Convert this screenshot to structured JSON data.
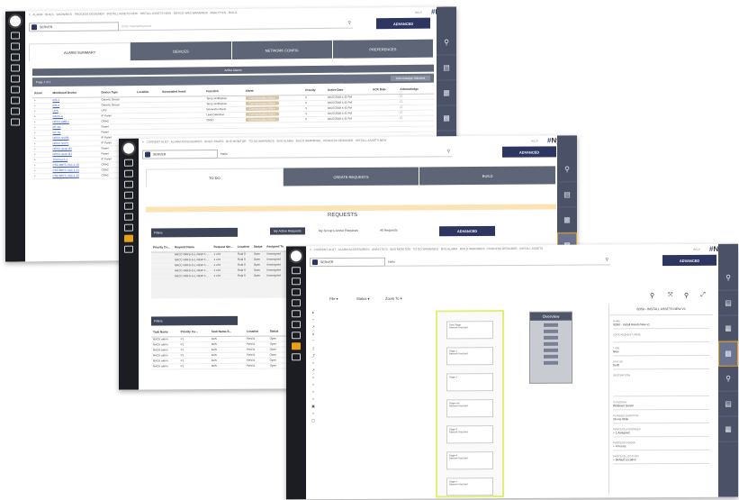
{
  "app": {
    "brand_left": "#",
    "brand_right": "Nyle",
    "help": "HELP",
    "server": "SERVER",
    "advanced": "ADVANCED"
  },
  "win1": {
    "crumbs": "# · ALARM · BUILD · WARNINGS · PROCESS DESIGNER · INSTALL ASSETS NEW · INSTALL ASSETS NEW · DEVICE WAS WARNINGS · ANALYTICS · BUILD",
    "search_placeholder": "Enter Name/keyword",
    "tabs": [
      "ALARM SUMMARY",
      "DEVICES",
      "NETWORK CONFIG",
      "PREFERENCES"
    ],
    "active_alarms": "Active Alarms",
    "page_label": "Page 1 of 1",
    "acknowledge_label": "Acknowledge Selected",
    "columns": [
      "Asset",
      "Monitored Device",
      "Device Type",
      "Location",
      "Associated Asset",
      "Function",
      "Alarm",
      "Priority",
      "Active Date",
      "ACK Date",
      "Acknowledge"
    ],
    "rows": [
      {
        "device": "RIS-1",
        "type": "Generic Device",
        "function": "Temp Verification",
        "alarm": "Communication Alarm",
        "priority": "5",
        "date": "04/27/2018 4:41 PM"
      },
      {
        "device": "RIS-2",
        "type": "Generic Device",
        "function": "Temp Verification",
        "alarm": "Communication Alarm",
        "priority": "5",
        "date": "04/27/2018 4:41 PM"
      },
      {
        "device": "UPS",
        "type": "UPS",
        "function": "Generator Alarm",
        "alarm": "Communication Alarm",
        "priority": "5",
        "date": "04/27/2018 4:41 PM"
      },
      {
        "device": "RACK-A",
        "type": "IP Panel",
        "function": "Leak Detection",
        "alarm": "Communication Alarm",
        "priority": "5",
        "date": "04/27/2018 4:41 PM"
      },
      {
        "device": "NRCC-ABB-1",
        "type": "CRAC",
        "function": "CRAC",
        "alarm": "Communication Alarm",
        "priority": "5",
        "date": "04/27/2018 4:41 PM"
      },
      {
        "device": "RF-4G",
        "type": "Power",
        "function": "",
        "alarm": "",
        "priority": "",
        "date": ""
      },
      {
        "device": "RF-4G",
        "type": "Power",
        "function": "",
        "alarm": "",
        "priority": "",
        "date": ""
      },
      {
        "device": "NRCC-SCRB",
        "type": "IP Panel",
        "function": "",
        "alarm": "",
        "priority": "",
        "date": ""
      },
      {
        "device": "NRCC-SCRY",
        "type": "IP Panel",
        "function": "",
        "alarm": "",
        "priority": "",
        "date": ""
      },
      {
        "device": "NRCC-Aeon-B3",
        "type": "Power",
        "function": "",
        "alarm": "",
        "priority": "",
        "date": ""
      },
      {
        "device": "NRCC-Aeon-B4",
        "type": "Power",
        "function": "",
        "alarm": "",
        "priority": "",
        "date": ""
      },
      {
        "device": "Thermal-S-1",
        "type": "IP Panel",
        "function": "",
        "alarm": "",
        "priority": "",
        "date": ""
      },
      {
        "device": "CSD-BRTC-VAC-1-40",
        "type": "CRAC",
        "function": "",
        "alarm": "",
        "priority": "",
        "date": ""
      },
      {
        "device": "CSD-BRTC-VAC-1-41",
        "type": "CRAC",
        "function": "",
        "alarm": "",
        "priority": "",
        "date": ""
      },
      {
        "device": "CSD-BRTC-VAC-1-42",
        "type": "CRAC",
        "function": "",
        "alarm": "",
        "priority": "",
        "date": ""
      }
    ]
  },
  "win2": {
    "crumbs": "# · CURRENT ALOT · ALARM ACCESSORIES · BUILD PAGES · BUS MONITOR · TO DO WARNINGS · BUS ALARM · BUILD WARNINGS · PROCESS DESIGNER · INSTALL ASSETS NEW",
    "search_value": "Hello",
    "tabs": [
      "TO DO",
      "CREATE REQUESTS",
      "BUILD"
    ],
    "requests_title": "REQUESTS",
    "filters": "Filters",
    "my_active": "My Active Requests",
    "group_active": "My Group's Active Requests",
    "all_requests": "All Requests",
    "advanced": "ADVANCED",
    "req_columns": [
      "Priority Co...",
      "Request Name",
      "Request Ste...",
      "Location",
      "Status",
      "Assigned To"
    ],
    "req_rows": [
      [
        "",
        "NRCC-NRFD-S-1-NEW-T-...",
        "1 of 6",
        "Field 8",
        "Open",
        "Unassigned"
      ],
      [
        "",
        "NRCC-NRFD-S-1-NEW-T-...",
        "1 of 6",
        "Field 8",
        "Open",
        "Unassigned"
      ],
      [
        "",
        "NRCC-NRFD-S-1-NEW-T-...",
        "1 of 6",
        "Field 8",
        "Open",
        "Unassigned"
      ],
      [
        "",
        "NRCC-NRFD-S-1-NEW-T-...",
        "1 of 6",
        "Field 8",
        "Open",
        "Unassigned"
      ],
      [
        "",
        "NRCC-NRFD-S-1-NEW-T-...",
        "1 of 6",
        "Field 8",
        "Open",
        "Unassigned"
      ]
    ],
    "filters2": "Filters",
    "task_columns": [
      "Task Name",
      "Priority Co...",
      "Task Name-S...",
      "Location",
      "Status"
    ],
    "task_rows": [
      [
        "RACK alarm",
        "P1",
        "BUS",
        "Field B",
        "Open"
      ],
      [
        "RACK alarm",
        "P1",
        "BUS",
        "Field B",
        "Open"
      ],
      [
        "RACK alarm",
        "P1",
        "BUS",
        "Field B",
        "Open"
      ],
      [
        "RACK alarm",
        "P1",
        "BUS",
        "Field B",
        "Open"
      ],
      [
        "RACK alarm",
        "P1",
        "BUS",
        "Field B",
        "Open"
      ],
      [
        "RACK alarm",
        "P1",
        "BUS",
        "Field B",
        "Open"
      ]
    ]
  },
  "win3": {
    "crumbs": "# · CURRENT ALOT · ALARM ACCESSORIES · ANALYTICS · BUS MONITOR · TO DO WARNINGS · BUS ALARM · BUILD WARNINGS · PROCESS DESIGNER · INSTALL ASSETS",
    "search_value": "Hello",
    "menus": [
      "File ▾",
      "Status ▾",
      "Zoom To ▾"
    ],
    "overview": "Overview",
    "nodes": [
      {
        "title": "Start Stage",
        "sub": "Network Required"
      },
      {
        "title": "Stage 1",
        "sub": "Network Required"
      },
      {
        "title": "Stage 2",
        "sub": ""
      },
      {
        "title": "Stage Info",
        "sub": "Network Required"
      },
      {
        "title": "Stage 3",
        "sub": "Network Required"
      },
      {
        "title": "Stage 4",
        "sub": "Network Required"
      },
      {
        "title": "Stage 5",
        "sub": "Network Required"
      }
    ],
    "prop_header": "SD50 - INSTALL ASSETS NEW V1",
    "props": [
      {
        "label": "NAME",
        "value": "SD50 - Install Assets New v1"
      },
      {
        "label": "LOCK REQUEST NAME",
        "value": ""
      },
      {
        "label": "TYPE",
        "value": "New"
      },
      {
        "label": "STATUS",
        "value": "Draft"
      },
      {
        "label": "DESCRIPTION",
        "value": ""
      },
      {
        "label": "CATEGORY",
        "value": "Windows Server"
      },
      {
        "label": "PLANNED DURATION",
        "value": "24 Hrs 0Min"
      },
      {
        "label": "PROCESS ASSIGNEES",
        "value": "+ 1 Assigned"
      },
      {
        "label": "PROCESS FORMS",
        "value": "+ 4 Forms"
      },
      {
        "label": "PROCESS LOCATION",
        "value": "+ Default Location"
      }
    ]
  }
}
